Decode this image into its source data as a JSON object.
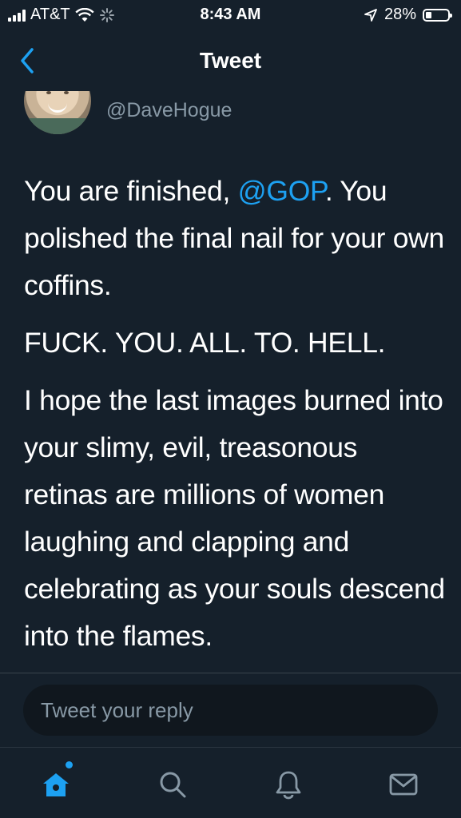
{
  "status_bar": {
    "carrier": "AT&T",
    "time": "8:43 AM",
    "battery": "28%",
    "battery_level": 0.28,
    "icons": [
      "signal-icon",
      "wifi-icon",
      "loading-spinner-icon",
      "location-arrow-icon",
      "battery-icon"
    ]
  },
  "nav": {
    "title": "Tweet",
    "back_icon": "chevron-left-icon"
  },
  "tweet": {
    "handle": "@DaveHogue",
    "paragraphs": [
      {
        "before": "You are finished, ",
        "mention": "@GOP",
        "after": ". You polished the final nail for your own coffins."
      },
      {
        "text": "FUCK. YOU. ALL. TO. HELL."
      },
      {
        "text": "I hope the last images burned into your slimy, evil, treasonous retinas are millions of women laughing and clapping and celebrating as your souls descend into the flames."
      }
    ]
  },
  "reply": {
    "placeholder": "Tweet your reply"
  },
  "tabs": [
    {
      "name": "home",
      "icon": "home-icon",
      "active": true
    },
    {
      "name": "search",
      "icon": "search-icon",
      "active": false
    },
    {
      "name": "notifications",
      "icon": "bell-icon",
      "active": false
    },
    {
      "name": "messages",
      "icon": "mail-icon",
      "active": false
    }
  ],
  "colors": {
    "background": "#15202b",
    "accent": "#1da1f2",
    "secondary_text": "#8899a6"
  }
}
